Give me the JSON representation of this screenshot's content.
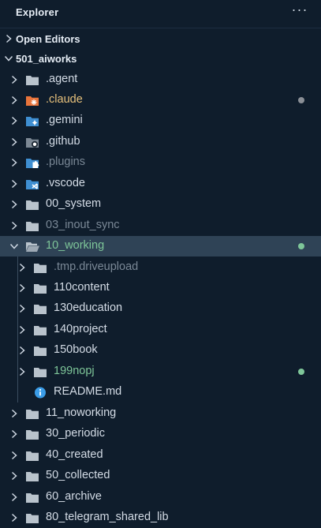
{
  "header": {
    "title": "Explorer",
    "more_label": "···"
  },
  "sections": {
    "open_editors": "Open Editors",
    "root": "501_aiworks"
  },
  "colors": {
    "background": "#0f1d2c",
    "selected": "#2f4356",
    "text": "#d4dce6",
    "dimmed": "#7a8896",
    "modified_yellow": "#e6c07b",
    "untracked_green": "#7ec699",
    "folder_gray": "#b9c3cc",
    "folder_blue": "#3f8fd2",
    "claude_orange": "#e8743b",
    "info_blue": "#3b9de8"
  },
  "tree": [
    {
      "label": ".agent",
      "icon": "folder-icon"
    },
    {
      "label": ".claude",
      "icon": "folder-claude-icon",
      "status": "modified"
    },
    {
      "label": ".gemini",
      "icon": "folder-gemini-icon"
    },
    {
      "label": ".github",
      "icon": "folder-github-icon"
    },
    {
      "label": ".plugins",
      "icon": "folder-plugins-icon",
      "dimmed": true
    },
    {
      "label": ".vscode",
      "icon": "folder-vscode-icon"
    },
    {
      "label": "00_system",
      "icon": "folder-icon"
    },
    {
      "label": "03_inout_sync",
      "icon": "folder-icon",
      "dimmed": true
    },
    {
      "label": "10_working",
      "icon": "folder-open-icon",
      "expanded": true,
      "selected": true,
      "status": "untracked"
    },
    {
      "label": ".tmp.driveupload",
      "icon": "folder-icon",
      "dimmed": true,
      "nested": true
    },
    {
      "label": "110content",
      "icon": "folder-icon",
      "nested": true
    },
    {
      "label": "130education",
      "icon": "folder-icon",
      "nested": true
    },
    {
      "label": "140project",
      "icon": "folder-icon",
      "nested": true
    },
    {
      "label": "150book",
      "icon": "folder-icon",
      "nested": true
    },
    {
      "label": "199nopj",
      "icon": "folder-icon",
      "nested": true,
      "status": "untracked"
    },
    {
      "label": "README.md",
      "icon": "info-icon",
      "nested": true,
      "file": true
    },
    {
      "label": "11_noworking",
      "icon": "folder-icon"
    },
    {
      "label": "30_periodic",
      "icon": "folder-icon"
    },
    {
      "label": "40_created",
      "icon": "folder-icon"
    },
    {
      "label": "50_collected",
      "icon": "folder-icon"
    },
    {
      "label": "60_archive",
      "icon": "folder-icon"
    },
    {
      "label": "80_telegram_shared_lib",
      "icon": "folder-icon"
    }
  ]
}
